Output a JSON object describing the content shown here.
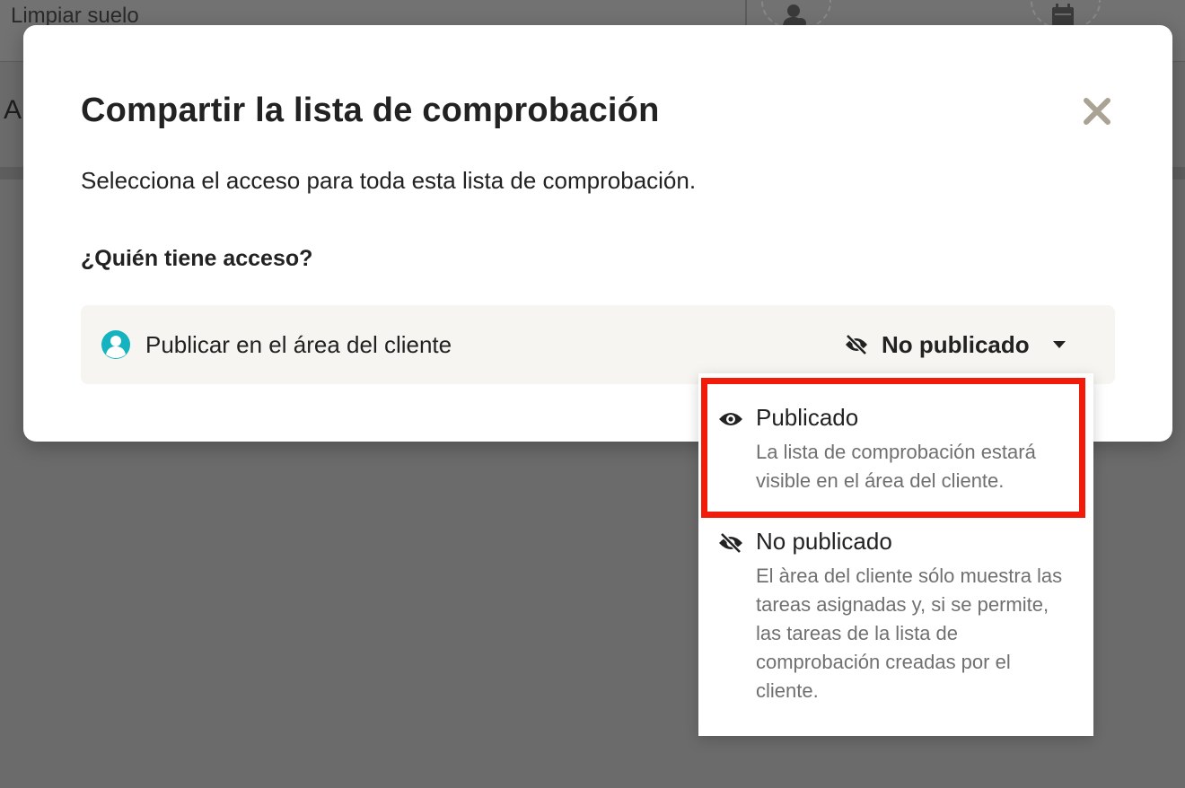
{
  "background": {
    "task_title": "Limpiar suelo",
    "partial_heading": "A",
    "icons": [
      "person-icon",
      "calendar-icon"
    ]
  },
  "modal": {
    "title": "Compartir la lista de comprobación",
    "close_icon": "close-icon",
    "description": "Selecciona el acceso para toda esta lista de comprobación.",
    "question": "¿Quién tiene acceso?",
    "access_row": {
      "icon": "client-area-icon",
      "label": "Publicar en el área del cliente",
      "status_icon": "eye-slash-icon",
      "status_value": "No publicado",
      "caret_icon": "caret-down-icon"
    }
  },
  "menu": {
    "options": [
      {
        "icon": "eye-icon",
        "label": "Publicado",
        "description": "La lista de comprobación estará visible en el área del cliente.",
        "highlighted": true
      },
      {
        "icon": "eye-slash-icon",
        "label": "No publicado",
        "description": "El àrea del cliente sólo muestra las tareas asignadas y, si se permite, las tareas de la lista de comprobación creadas por el cliente.",
        "highlighted": false
      }
    ]
  },
  "colors": {
    "overlay": "#6b6b6b",
    "accent_teal": "#14b3bf",
    "highlight_red": "#f21a09",
    "close_gray": "#aaa293",
    "row_bg": "#f6f5f1"
  }
}
